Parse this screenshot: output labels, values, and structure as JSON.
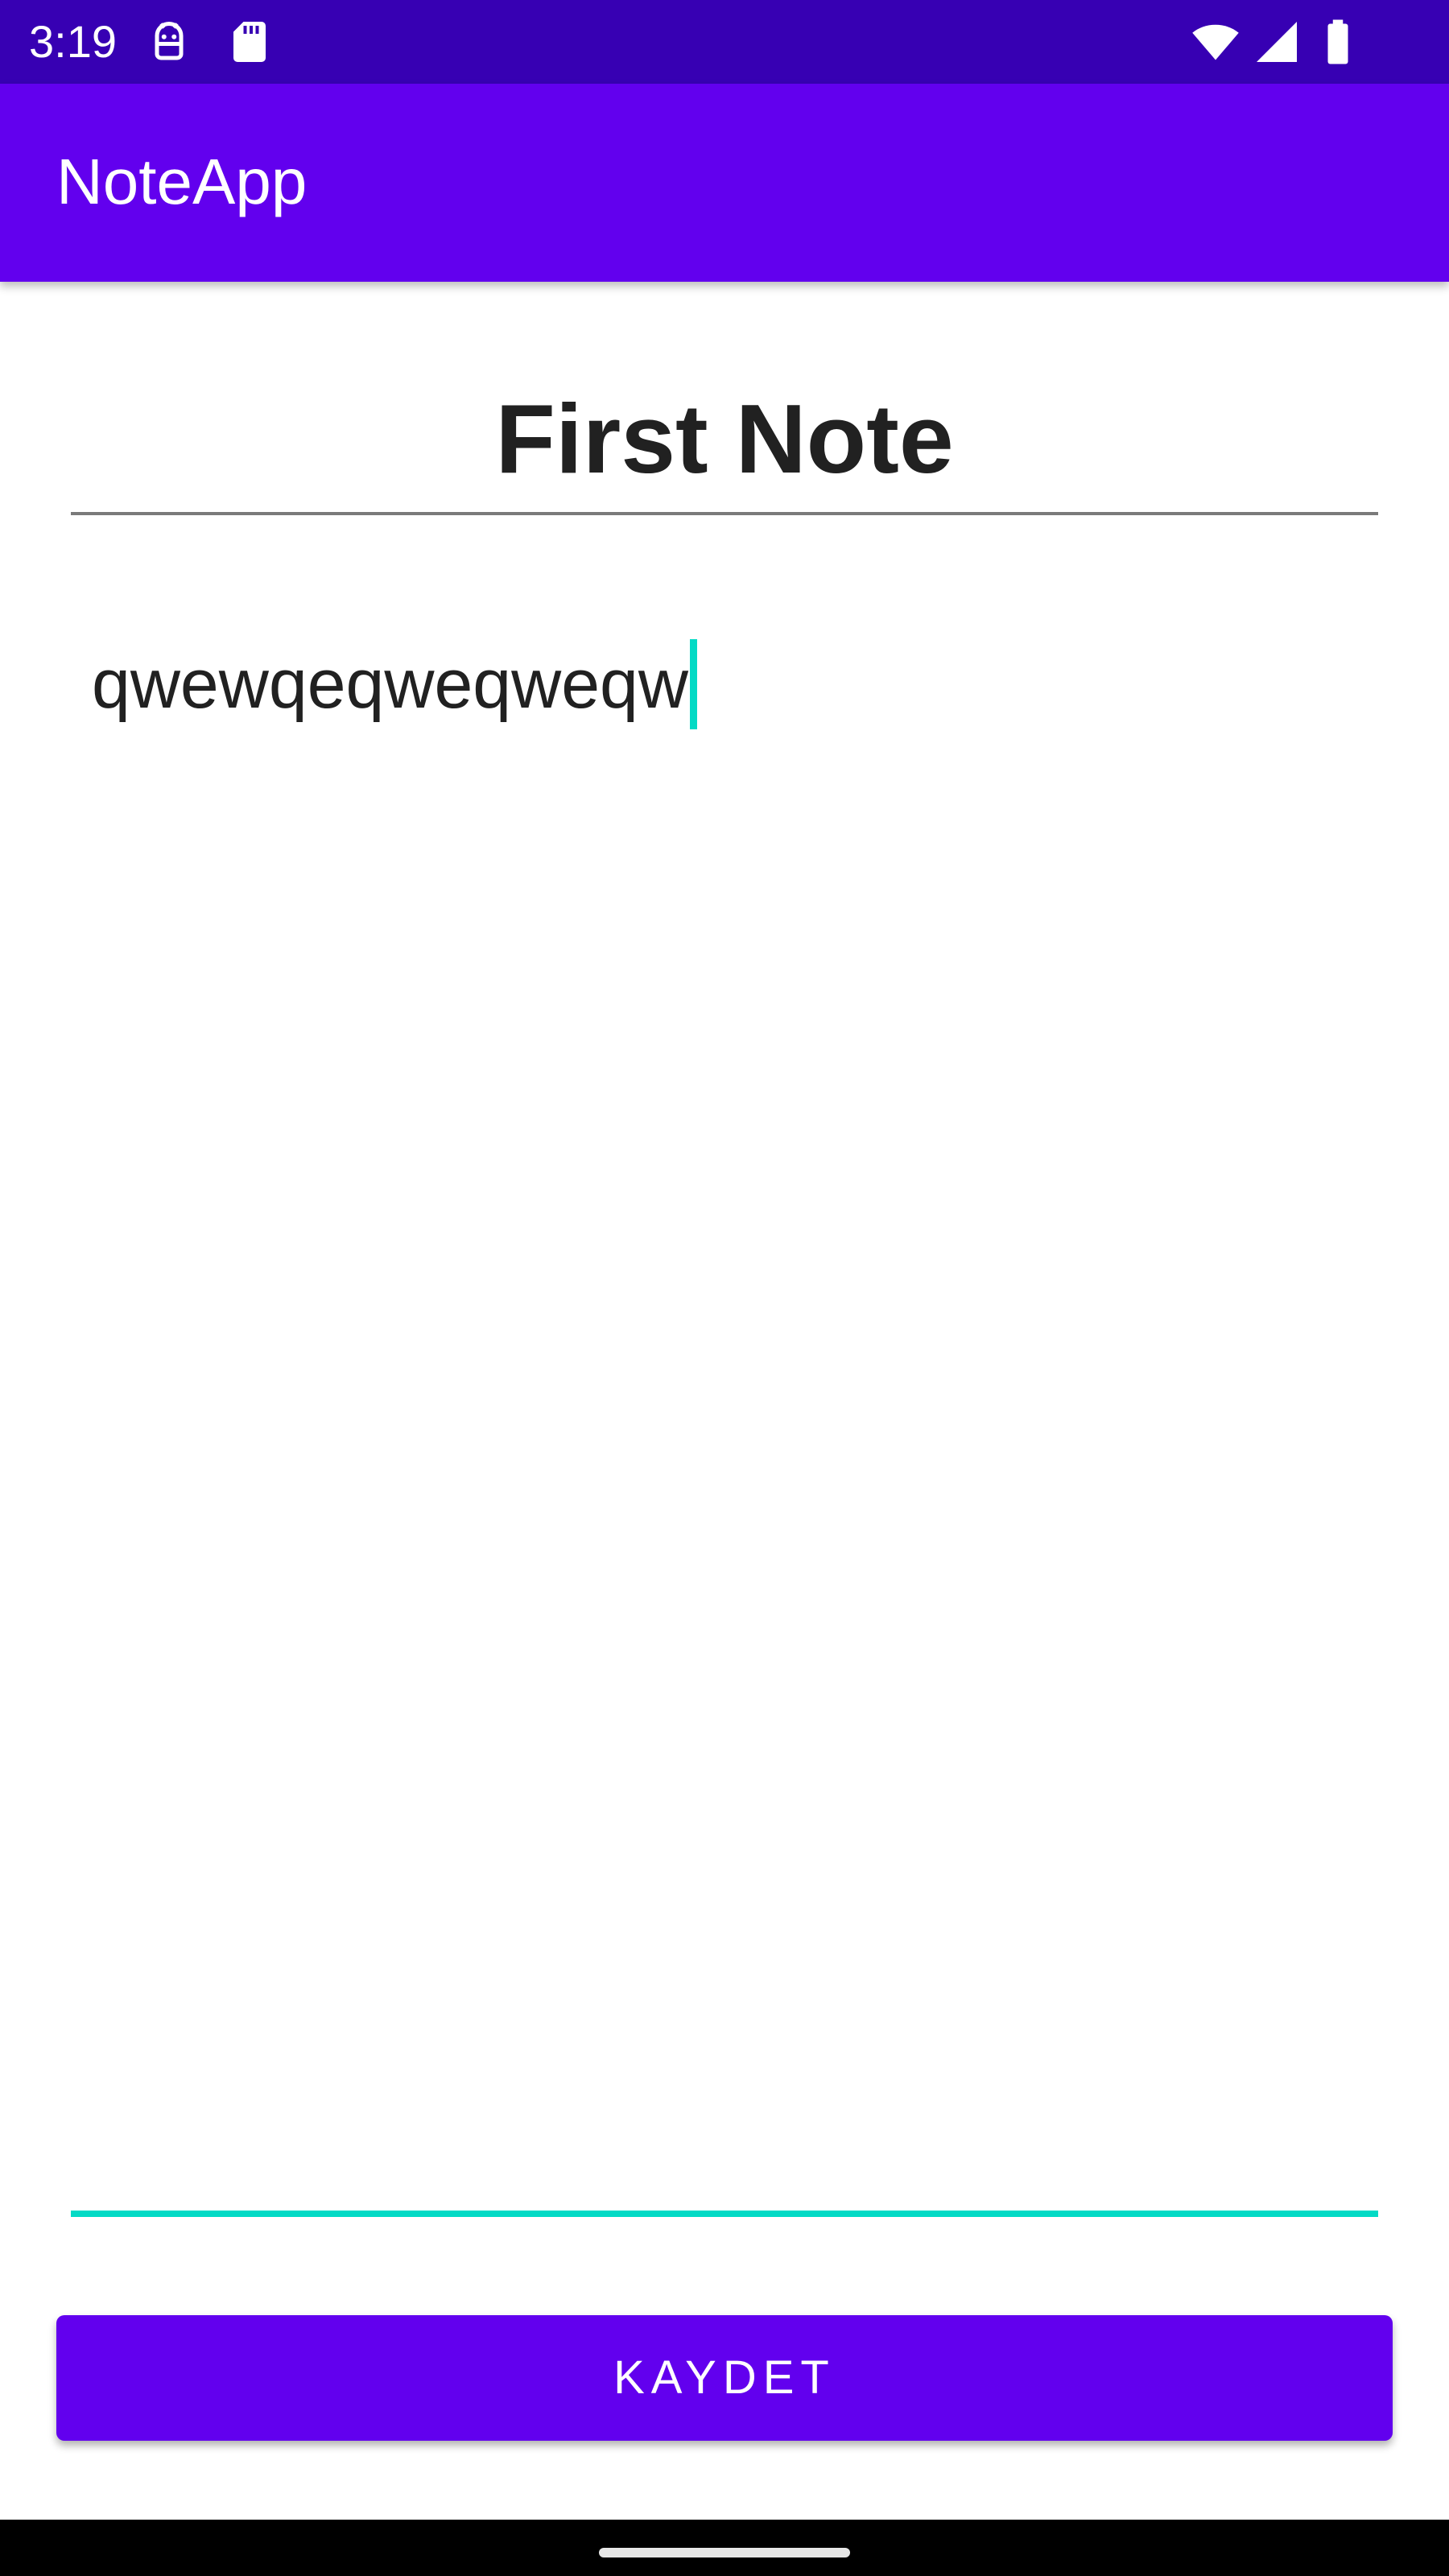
{
  "status_bar": {
    "time": "3:19",
    "icons": [
      "android-debug-icon",
      "sd-card-icon",
      "wifi-icon",
      "cell-signal-icon",
      "battery-icon"
    ]
  },
  "app_bar": {
    "title": "NoteApp"
  },
  "note": {
    "title_value": "First Note",
    "body_value": "qwewqeqweqweqw"
  },
  "actions": {
    "save_label": "KAYDET"
  },
  "colors": {
    "status_bar": "#3700b3",
    "primary": "#6200ee",
    "accent": "#03dac5",
    "text": "#212121"
  }
}
